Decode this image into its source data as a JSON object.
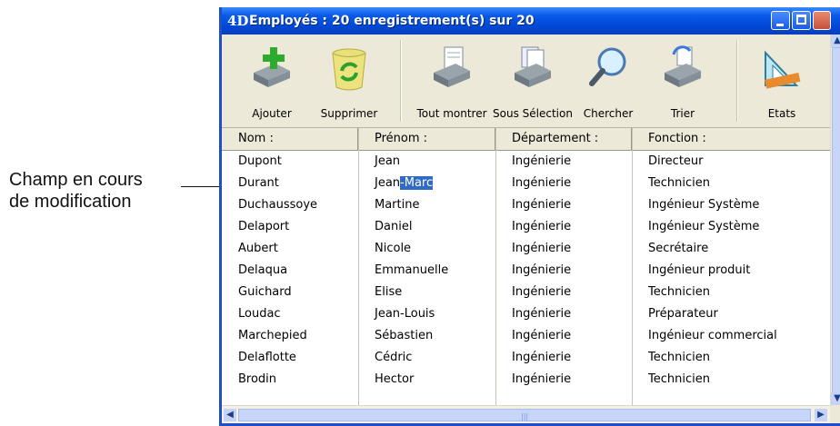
{
  "callout": {
    "line1": "Champ en cours",
    "line2": "de modification"
  },
  "window": {
    "app_icon": "4D",
    "title": "Employés : 20 enregistrement(s) sur 20"
  },
  "toolbar": {
    "add": "Ajouter",
    "delete": "Supprimer",
    "show_all": "Tout montrer",
    "subset": "Sous Sélection",
    "search": "Chercher",
    "sort": "Trier",
    "reports": "Etats"
  },
  "table": {
    "headers": [
      "Nom :",
      "Prénom :",
      "Département :",
      "Fonction :"
    ],
    "editing": {
      "typed": "Jean",
      "selected": "-Marc"
    },
    "rows": [
      [
        "Dupont",
        "Jean",
        "Ingénierie",
        "Directeur"
      ],
      [
        "Durant",
        "Jean-Marc",
        "Ingénierie",
        "Technicien"
      ],
      [
        "Duchaussoye",
        "Martine",
        "Ingénierie",
        "Ingénieur Système"
      ],
      [
        "Delaport",
        "Daniel",
        "Ingénierie",
        "Ingénieur Système"
      ],
      [
        "Aubert",
        "Nicole",
        "Ingénierie",
        "Secrétaire"
      ],
      [
        "Delaqua",
        "Emmanuelle",
        "Ingénierie",
        "Ingénieur produit"
      ],
      [
        "Guichard",
        "Elise",
        "Ingénierie",
        "Technicien"
      ],
      [
        "Loudac",
        "Jean-Louis",
        "Ingénierie",
        "Préparateur"
      ],
      [
        "Marchepied",
        "Sébastien",
        "Ingénierie",
        "Ingénieur commercial"
      ],
      [
        "Delaflotte",
        "Cédric",
        "Ingénierie",
        "Technicien"
      ],
      [
        "Brodin",
        "Hector",
        "Ingénierie",
        "Technicien"
      ]
    ]
  },
  "colors": {
    "titlebar": "#0a5ae8",
    "selection": "#316ac5",
    "window_bg": "#ece9d8"
  }
}
